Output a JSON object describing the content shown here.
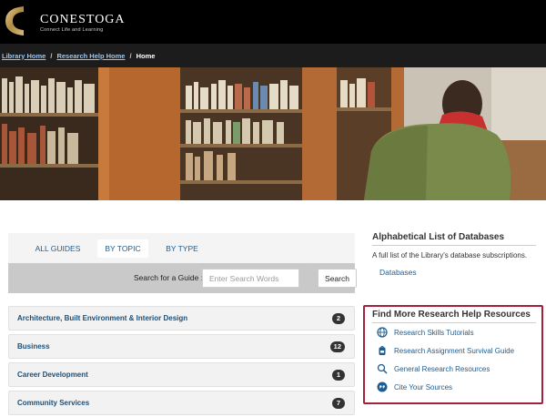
{
  "header": {
    "brand": "CONESTOGA",
    "tagline": "Connect Life and Learning"
  },
  "breadcrumb": {
    "items": [
      {
        "label": "Library Home"
      },
      {
        "label": "Research Help Home"
      }
    ],
    "separator": "/",
    "current": "Home"
  },
  "guides": {
    "tabs": [
      {
        "label": "ALL GUIDES",
        "active": false
      },
      {
        "label": "BY TOPIC",
        "active": true
      },
      {
        "label": "BY TYPE",
        "active": false
      }
    ],
    "search": {
      "label": "Search for a Guide :",
      "placeholder": "Enter Search Words",
      "button": "Search"
    },
    "topics": [
      {
        "label": "Architecture, Built Environment & Interior Design",
        "count": "2"
      },
      {
        "label": "Business",
        "count": "12"
      },
      {
        "label": "Career Development",
        "count": "1"
      },
      {
        "label": "Community Services",
        "count": "7"
      }
    ]
  },
  "az": {
    "title": "Alphabetical List of Databases",
    "description": "A full list of the Library's database subscriptions.",
    "link": "Databases"
  },
  "research_help": {
    "title": "Find More Research Help Resources",
    "items": [
      {
        "label": "Research Skills Tutorials",
        "icon": "globe-icon"
      },
      {
        "label": "Research Assignment Survival Guide",
        "icon": "backpack-icon"
      },
      {
        "label": "General Research Resources",
        "icon": "magnifier-icon"
      },
      {
        "label": "Cite Your Sources",
        "icon": "quote-bubble-icon"
      }
    ]
  },
  "colors": {
    "header_bg": "#000000",
    "link": "#1d5d91",
    "highlight_border": "#a3213a",
    "badge": "#333333"
  }
}
